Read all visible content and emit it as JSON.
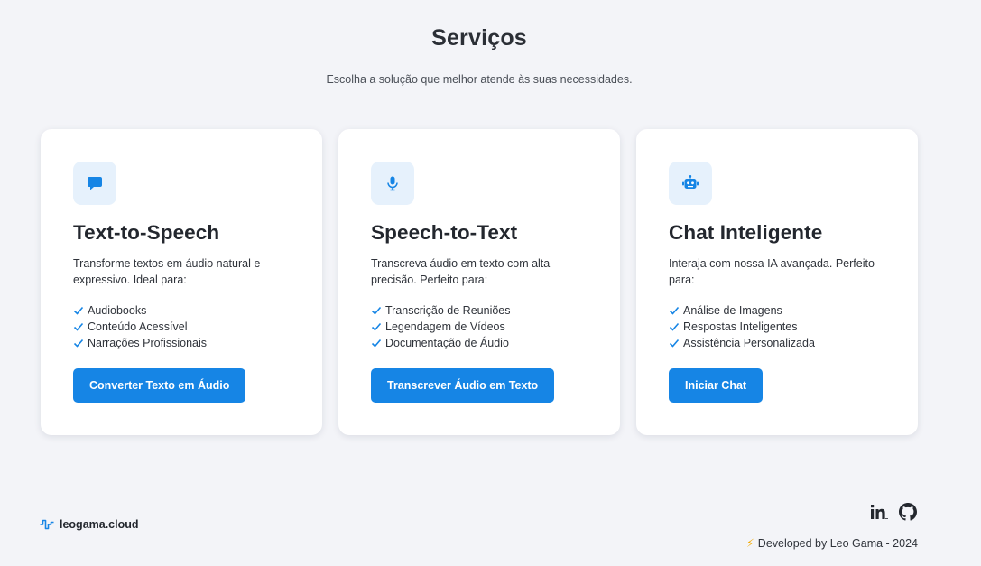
{
  "header": {
    "title": "Serviços",
    "subtitle": "Escolha a solução que melhor atende às suas necessidades."
  },
  "cards": [
    {
      "icon": "chat-bubble-icon",
      "title": "Text-to-Speech",
      "description": "Transforme textos em áudio natural e expressivo. Ideal para:",
      "features": [
        "Audiobooks",
        "Conteúdo Acessível",
        "Narrações Profissionais"
      ],
      "button": "Converter Texto em Áudio"
    },
    {
      "icon": "microphone-icon",
      "title": "Speech-to-Text",
      "description": "Transcreva áudio em texto com alta precisão. Perfeito para:",
      "features": [
        "Transcrição de Reuniões",
        "Legendagem de Vídeos",
        "Documentação de Áudio"
      ],
      "button": "Transcrever Áudio em Texto"
    },
    {
      "icon": "robot-icon",
      "title": "Chat Inteligente",
      "description": "Interaja com nossa IA avançada. Perfeito para:",
      "features": [
        "Análise de Imagens",
        "Respostas Inteligentes",
        "Assistência Personalizada"
      ],
      "button": "Iniciar Chat"
    }
  ],
  "footer": {
    "brand": "leogama.cloud",
    "credit": "Developed by Leo Gama - 2024",
    "socials": [
      "linkedin-icon",
      "github-icon"
    ]
  },
  "colors": {
    "accent": "#1685e5",
    "icon_bg": "#e6f1fc",
    "background": "#f3f4f8"
  }
}
